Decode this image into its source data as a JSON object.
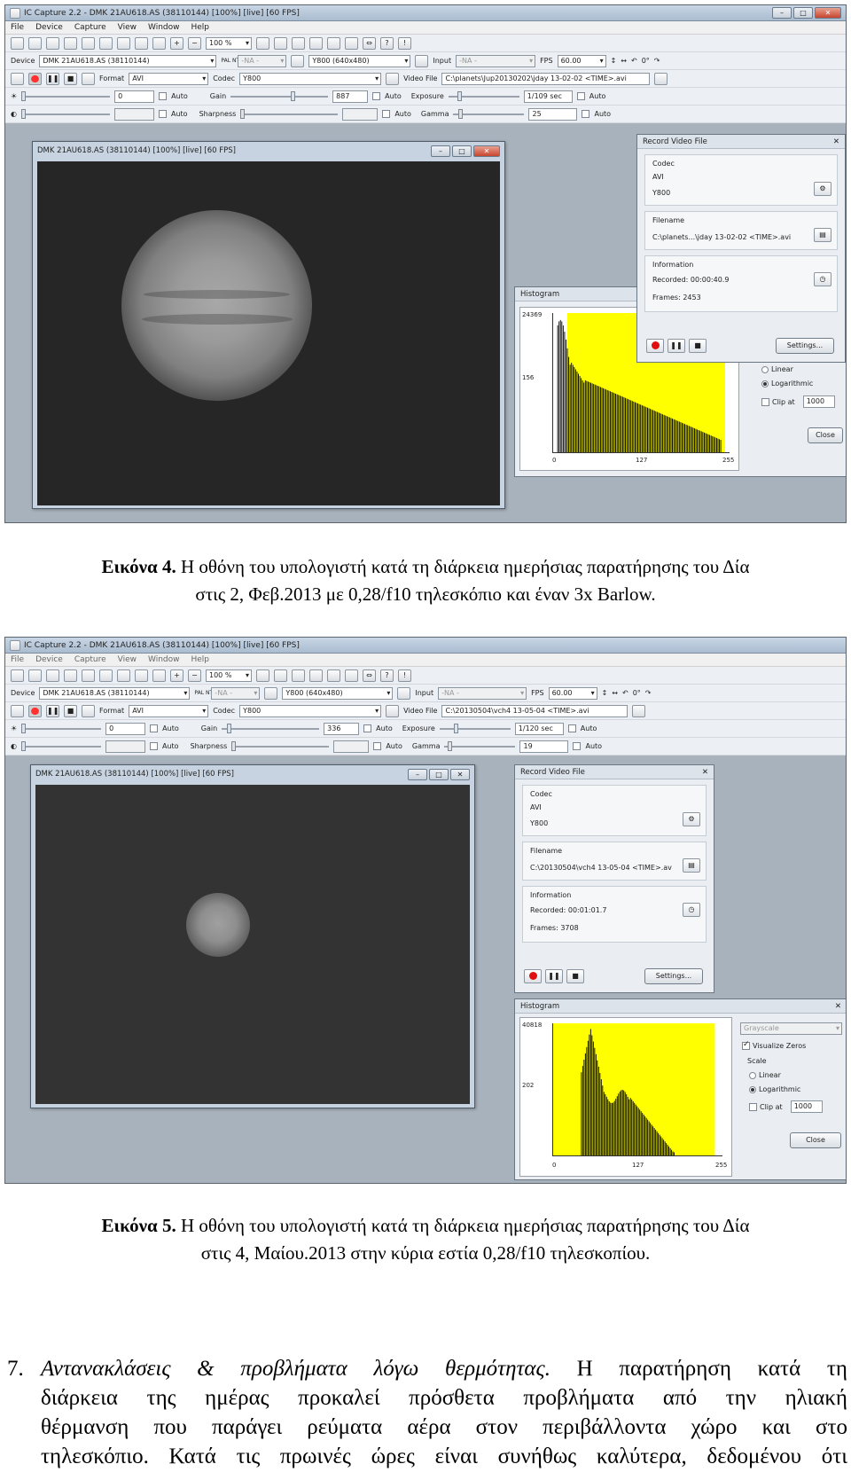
{
  "screenshots": [
    {
      "window_title": "IC Capture 2.2 - DMK 21AU618.AS (38110144) [100%]  [live]  [60 FPS]",
      "menu": [
        "File",
        "Device",
        "Capture",
        "View",
        "Window",
        "Help"
      ],
      "zoom": "100 %",
      "device_label": "Device",
      "device": "DMK 21AU618.AS (38110144)",
      "pal": "PAL NTSC",
      "na": "-NA -",
      "format_video": "Y800 (640x480)",
      "input_label": "Input",
      "input_value": "-NA -",
      "fps_label": "FPS",
      "fps": "60.00",
      "rotation": "0°",
      "format_label": "Format",
      "format": "AVI",
      "codec_label": "Codec",
      "codec": "Y800",
      "videofile_label": "Video File",
      "videofile": "C:\\planets\\Jup20130202\\jday 13-02-02 <TIME>.avi",
      "brightness": "0",
      "auto": "Auto",
      "gain_label": "Gain",
      "gain": "887",
      "exposure_label": "Exposure",
      "exposure": "1/109 sec",
      "sharpness_label": "Sharpness",
      "gamma_label": "Gamma",
      "gamma": "25",
      "preview_title": "DMK 21AU618.AS (38110144) [100%]  [live]  [60 FPS]",
      "record": {
        "title": "Record Video File",
        "codec_heading": "Codec",
        "codec_container": "AVI",
        "codec_name": "Y800",
        "filename_heading": "Filename",
        "filename": "C:\\planets...\\jday 13-02-02 <TIME>.avi",
        "info_heading": "Information",
        "recorded": "Recorded: 00:00:40.9",
        "frames": "Frames: 2453",
        "settings": "Settings..."
      },
      "histogram": {
        "title": "Histogram",
        "ymax": "24369",
        "ymid": "156",
        "x0": "0",
        "x127": "127",
        "x255": "255",
        "linear": "Linear",
        "logarithmic": "Logarithmic",
        "clip": "Clip at",
        "clip_value": "1000",
        "close": "Close"
      }
    },
    {
      "window_title": "IC Capture 2.2 - DMK 21AU618.AS (38110144) [100%]  [live]  [60 FPS]",
      "menu": [
        "File",
        "Device",
        "Capture",
        "View",
        "Window",
        "Help"
      ],
      "zoom": "100 %",
      "device_label": "Device",
      "device": "DMK 21AU618.AS (38110144)",
      "pal": "PAL NTSC",
      "na": "-NA -",
      "format_video": "Y800 (640x480)",
      "input_label": "Input",
      "input_value": "-NA -",
      "fps_label": "FPS",
      "fps": "60.00",
      "rotation": "0°",
      "format_label": "Format",
      "format": "AVI",
      "codec_label": "Codec",
      "codec": "Y800",
      "videofile_label": "Video File",
      "videofile": "C:\\20130504\\vch4 13-05-04 <TIME>.avi",
      "brightness": "0",
      "auto": "Auto",
      "gain_label": "Gain",
      "gain": "336",
      "exposure_label": "Exposure",
      "exposure": "1/120 sec",
      "sharpness_label": "Sharpness",
      "gamma_label": "Gamma",
      "gamma": "19",
      "preview_title": "DMK 21AU618.AS (38110144) [100%]  [live]  [60 FPS]",
      "record": {
        "title": "Record Video File",
        "codec_heading": "Codec",
        "codec_container": "AVI",
        "codec_name": "Y800",
        "filename_heading": "Filename",
        "filename": "C:\\20130504\\vch4 13-05-04 <TIME>.av",
        "info_heading": "Information",
        "recorded": "Recorded: 00:01:01.7",
        "frames": "Frames: 3708",
        "settings": "Settings..."
      },
      "histogram": {
        "title": "Histogram",
        "ymax": "40818",
        "ymid": "202",
        "x0": "0",
        "x127": "127",
        "x255": "255",
        "grayscale": "Grayscale",
        "visualize": "Visualize Zeros",
        "scale": "Scale",
        "linear": "Linear",
        "logarithmic": "Logarithmic",
        "clip": "Clip at",
        "clip_value": "1000",
        "close": "Close"
      }
    }
  ],
  "captions": [
    {
      "label": "Εικόνα 4.",
      "line1": " Η οθόνη του υπολογιστή κατά τη διάρκεια ημερήσιας παρατήρησης του Δία",
      "line2": "στις 2, Φεβ.2013 με  0,28/f10 τηλεσκόπιο και έναν 3x Barlow."
    },
    {
      "label": "Εικόνα 5.",
      "line1": " Η οθόνη του υπολογιστή κατά τη διάρκεια ημερήσιας παρατήρησης του Δία",
      "line2": "στις 4, Μαίου.2013 στην κύρια εστία 0,28/f10 τηλεσκοπίου."
    }
  ],
  "paragraph": {
    "number": "7.",
    "italic": "Αντανακλάσεις & προβλήματα λόγω θερμότητας.",
    "line1": " Η παρατήρηση κατά τη",
    "line2": "διάρκεια της ημέρας προκαλεί πρόσθετα προβλήματα από την ηλιακή",
    "line3": "θέρμανση που παράγει ρεύματα αέρα στον περιβάλλοντα χώρο και στο",
    "line4": "τηλεσκόπιο. Κατά τις πρωινές ώρες είναι συνήθως καλύτερα, δεδομένου ότι"
  },
  "colors": {
    "histogram_fill": "#ffff00",
    "histogram_bars": "#000000",
    "titlebar": "#b9c9db"
  }
}
